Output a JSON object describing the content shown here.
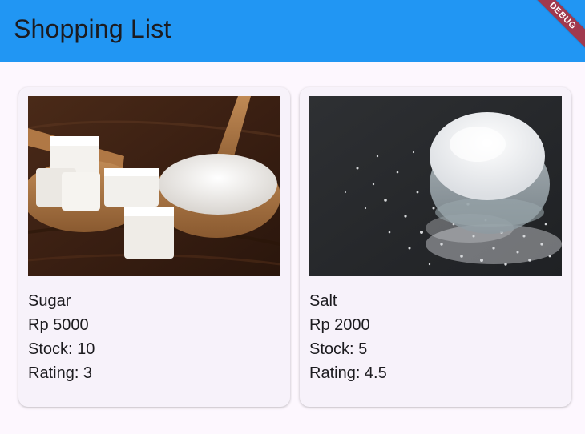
{
  "appbar": {
    "title": "Shopping List",
    "debug_label": "DEBUG",
    "color": "#2196f3"
  },
  "products": [
    {
      "name": "Sugar",
      "price": "Rp 5000",
      "stock": "Stock: 10",
      "rating": "Rating: 3",
      "image": "sugar-photo"
    },
    {
      "name": "Salt",
      "price": "Rp 2000",
      "stock": "Stock: 5",
      "rating": "Rating: 4.5",
      "image": "salt-photo"
    }
  ]
}
